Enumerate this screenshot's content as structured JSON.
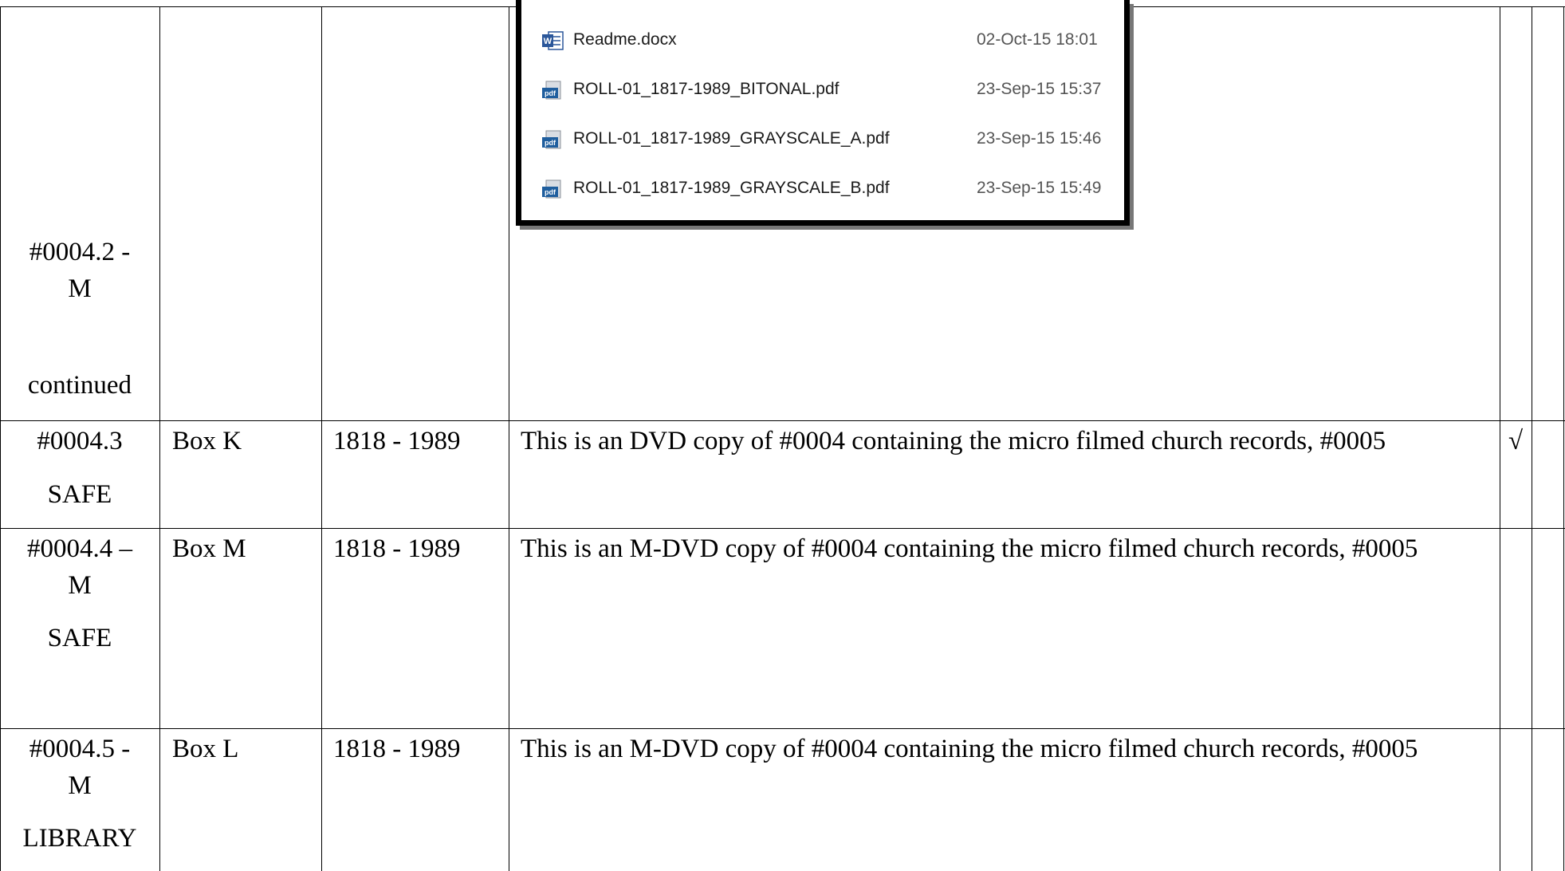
{
  "files": [
    {
      "name": "Readme.docx",
      "date": "02-Oct-15 18:01",
      "icon": "word-doc-icon"
    },
    {
      "name": "ROLL-01_1817-1989_BITONAL.pdf",
      "date": "23-Sep-15 15:37",
      "icon": "pdf-icon"
    },
    {
      "name": "ROLL-01_1817-1989_GRAYSCALE_A.pdf",
      "date": "23-Sep-15 15:46",
      "icon": "pdf-icon"
    },
    {
      "name": "ROLL-01_1817-1989_GRAYSCALE_B.pdf",
      "date": "23-Sep-15 15:49",
      "icon": "pdf-icon"
    }
  ],
  "rows": [
    {
      "id_line1": "#0004.2 -",
      "id_line2": "M",
      "id_line3": "continued"
    },
    {
      "id_line1": "#0004.3",
      "id_line2": "SAFE",
      "box": "Box K",
      "dates": "1818 - 1989",
      "description": "This is an DVD copy of #0004 containing the micro filmed church records, #0005",
      "check": "√"
    },
    {
      "id_line1": "#0004.4 –",
      "id_line2": "M",
      "id_line3": "SAFE",
      "box": "Box M",
      "dates": "1818 - 1989",
      "description": "This is an M-DVD copy of #0004 containing the micro filmed church records, #0005"
    },
    {
      "id_line1": "#0004.5 -",
      "id_line2": "M",
      "id_line3": "LIBRARY",
      "box": "Box L",
      "dates": "1818 - 1989",
      "description": "This is an M-DVD copy of #0004 containing the micro filmed church records, #0005"
    }
  ]
}
